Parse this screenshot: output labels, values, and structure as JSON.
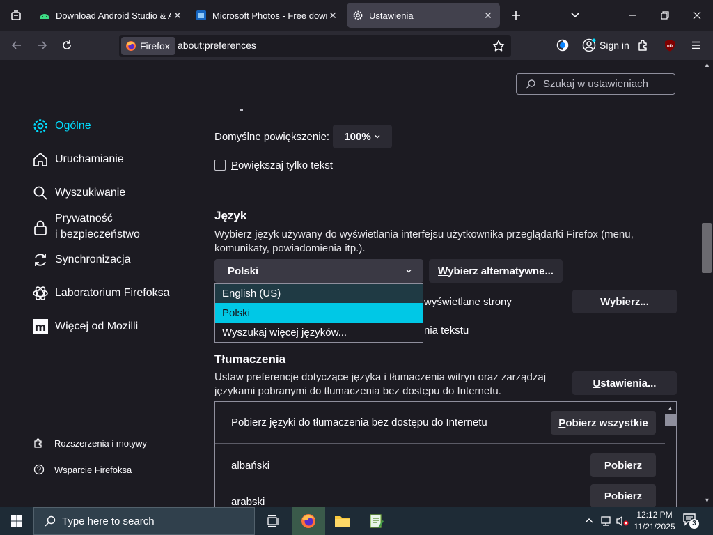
{
  "tabs": [
    {
      "title": "Download Android Studio & Ap",
      "icon": "android-icon"
    },
    {
      "title": "Microsoft Photos - Free downlo",
      "icon": "photos-icon"
    },
    {
      "title": "Ustawienia",
      "icon": "gear-icon"
    }
  ],
  "navbar": {
    "identity_label": "Firefox",
    "url": "about:preferences",
    "sign_in": "Sign in"
  },
  "search": {
    "placeholder": "Szukaj w ustawieniach"
  },
  "sidebar": {
    "items": [
      {
        "label": "Ogólne",
        "icon": "gear-icon"
      },
      {
        "label": "Uruchamianie",
        "icon": "home-icon"
      },
      {
        "label": "Wyszukiwanie",
        "icon": "search-icon"
      },
      {
        "label": "Prywatność",
        "label2": "i bezpieczeństwo",
        "icon": "lock-icon"
      },
      {
        "label": "Synchronizacja",
        "icon": "sync-icon"
      },
      {
        "label": "Laboratorium Firefoksa",
        "icon": "flask-icon"
      },
      {
        "label": "Więcej od Mozilli",
        "icon": "mozilla-icon"
      }
    ],
    "footer": [
      {
        "label": "Rozszerzenia i motywy",
        "icon": "puzzle-icon"
      },
      {
        "label": "Wsparcie Firefoksa",
        "icon": "help-icon"
      }
    ]
  },
  "zoom": {
    "label_first": "D",
    "label_rest": "omyślne powiększenie:",
    "value": "100%",
    "text_only_first": "P",
    "text_only_rest": "owiększaj tylko tekst"
  },
  "language": {
    "heading": "Język",
    "description_line1": "Wybierz język używany do wyświetlania interfejsu użytkownika przeglądarki Firefox (menu,",
    "description_line2": "komunikaty, powiadomienia itp.).",
    "selected": "Polski",
    "alternative_first": "W",
    "alternative_rest": "ybierz alternatywne...",
    "pages_text_tail": "wyświetlane strony",
    "choose_first": "",
    "choose_label": "Wybierz...",
    "spellcheck_tail": "nia tekstu",
    "options": [
      "English (US)",
      "Polski",
      "Wyszukaj więcej języków..."
    ]
  },
  "translations": {
    "heading": "Tłumaczenia",
    "description_line1": "Ustaw preferencje dotyczące języka i tłumaczenia witryn oraz zarządzaj",
    "description_line2": "językami pobranymi do tłumaczenia bez dostępu do Internetu.",
    "settings_first": "U",
    "settings_rest": "stawienia...",
    "download_header": "Pobierz języki do tłumaczenia bez dostępu do Internetu",
    "download_all_first": "P",
    "download_all_rest": "obierz wszystkie",
    "languages": [
      {
        "name": "albański",
        "action": "Pobierz"
      },
      {
        "name": "arabski",
        "action": "Pobierz"
      }
    ]
  },
  "taskbar": {
    "search_placeholder": "Type here to search",
    "time": "12:12 PM",
    "date": "11/21/2025",
    "notifications": "3"
  }
}
